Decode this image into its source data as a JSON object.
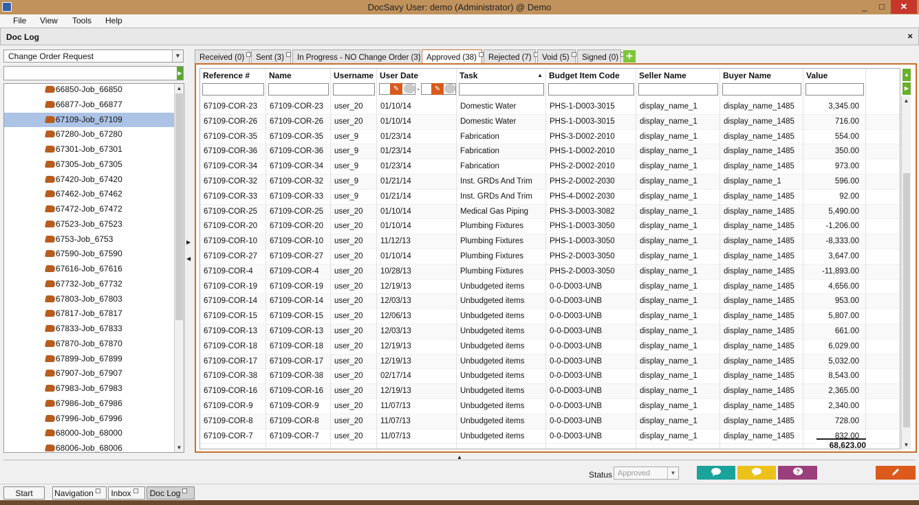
{
  "window": {
    "title": "DocSavy   User: demo (Administrator) @ Demo",
    "min_label": "_",
    "max_label": "□",
    "close_label": "✕"
  },
  "menu": [
    "File",
    "View",
    "Tools",
    "Help"
  ],
  "doclog": {
    "title": "Doc Log",
    "close_label": "×"
  },
  "doc_type": {
    "selected": "Change Order Request"
  },
  "tree": {
    "items": [
      "66850-Job_66850",
      "66877-Job_66877",
      "67109-Job_67109",
      "67280-Job_67280",
      "67301-Job_67301",
      "67305-Job_67305",
      "67420-Job_67420",
      "67462-Job_67462",
      "67472-Job_67472",
      "67523-Job_67523",
      "6753-Job_6753",
      "67590-Job_67590",
      "67616-Job_67616",
      "67732-Job_67732",
      "67803-Job_67803",
      "67817-Job_67817",
      "67833-Job_67833",
      "67870-Job_67870",
      "67899-Job_67899",
      "67907-Job_67907",
      "67983-Job_67983",
      "67986-Job_67986",
      "67996-Job_67996",
      "68000-Job_68000",
      "68006-Job_68006"
    ],
    "selected_index": 2
  },
  "tabs": [
    "Received (0)",
    "Sent (3)",
    "In Progress - NO Change Order (3)",
    "Approved (38)",
    "Rejected (7)",
    "Void (5)",
    "Signed (0)"
  ],
  "active_tab": 3,
  "add_tab_label": "+",
  "columns": [
    "Reference #",
    "Name",
    "Username",
    "User Date",
    "Task",
    "Budget Item Code",
    "Seller Name",
    "Buyer Name",
    "Value"
  ],
  "sort_indicator": "▲",
  "date_separator": "-",
  "rows": [
    [
      "67109-COR-23",
      "67109-COR-23",
      "user_20",
      "01/10/14",
      "Domestic Water",
      "PHS-1-D003-3015",
      "display_name_1",
      "display_name_1485",
      "3,345.00"
    ],
    [
      "67109-COR-26",
      "67109-COR-26",
      "user_20",
      "01/10/14",
      "Domestic Water",
      "PHS-1-D003-3015",
      "display_name_1",
      "display_name_1485",
      "716.00"
    ],
    [
      "67109-COR-35",
      "67109-COR-35",
      "user_9",
      "01/23/14",
      "Fabrication",
      "PHS-3-D002-2010",
      "display_name_1",
      "display_name_1485",
      "554.00"
    ],
    [
      "67109-COR-36",
      "67109-COR-36",
      "user_9",
      "01/23/14",
      "Fabrication",
      "PHS-1-D002-2010",
      "display_name_1",
      "display_name_1485",
      "350.00"
    ],
    [
      "67109-COR-34",
      "67109-COR-34",
      "user_9",
      "01/23/14",
      "Fabrication",
      "PHS-2-D002-2010",
      "display_name_1",
      "display_name_1485",
      "973.00"
    ],
    [
      "67109-COR-32",
      "67109-COR-32",
      "user_9",
      "01/21/14",
      "Inst. GRDs And Trim",
      "PHS-2-D002-2030",
      "display_name_1",
      "display_name_1",
      "596.00"
    ],
    [
      "67109-COR-33",
      "67109-COR-33",
      "user_9",
      "01/21/14",
      "Inst. GRDs And Trim",
      "PHS-4-D002-2030",
      "display_name_1",
      "display_name_1485",
      "92.00"
    ],
    [
      "67109-COR-25",
      "67109-COR-25",
      "user_20",
      "01/10/14",
      "Medical Gas Piping",
      "PHS-3-D003-3082",
      "display_name_1",
      "display_name_1485",
      "5,490.00"
    ],
    [
      "67109-COR-20",
      "67109-COR-20",
      "user_20",
      "01/10/14",
      "Plumbing Fixtures",
      "PHS-1-D003-3050",
      "display_name_1",
      "display_name_1485",
      "-1,206.00"
    ],
    [
      "67109-COR-10",
      "67109-COR-10",
      "user_20",
      "11/12/13",
      "Plumbing Fixtures",
      "PHS-1-D003-3050",
      "display_name_1",
      "display_name_1485",
      "-8,333.00"
    ],
    [
      "67109-COR-27",
      "67109-COR-27",
      "user_20",
      "01/10/14",
      "Plumbing Fixtures",
      "PHS-2-D003-3050",
      "display_name_1",
      "display_name_1485",
      "3,647.00"
    ],
    [
      "67109-COR-4",
      "67109-COR-4",
      "user_20",
      "10/28/13",
      "Plumbing Fixtures",
      "PHS-2-D003-3050",
      "display_name_1",
      "display_name_1485",
      "-11,893.00"
    ],
    [
      "67109-COR-19",
      "67109-COR-19",
      "user_20",
      "12/19/13",
      "Unbudgeted items",
      "0-0-D003-UNB",
      "display_name_1",
      "display_name_1485",
      "4,656.00"
    ],
    [
      "67109-COR-14",
      "67109-COR-14",
      "user_20",
      "12/03/13",
      "Unbudgeted items",
      "0-0-D003-UNB",
      "display_name_1",
      "display_name_1485",
      "953.00"
    ],
    [
      "67109-COR-15",
      "67109-COR-15",
      "user_20",
      "12/06/13",
      "Unbudgeted items",
      "0-0-D003-UNB",
      "display_name_1",
      "display_name_1485",
      "5,807.00"
    ],
    [
      "67109-COR-13",
      "67109-COR-13",
      "user_20",
      "12/03/13",
      "Unbudgeted items",
      "0-0-D003-UNB",
      "display_name_1",
      "display_name_1485",
      "661.00"
    ],
    [
      "67109-COR-18",
      "67109-COR-18",
      "user_20",
      "12/19/13",
      "Unbudgeted items",
      "0-0-D003-UNB",
      "display_name_1",
      "display_name_1485",
      "6,029.00"
    ],
    [
      "67109-COR-17",
      "67109-COR-17",
      "user_20",
      "12/19/13",
      "Unbudgeted items",
      "0-0-D003-UNB",
      "display_name_1",
      "display_name_1485",
      "5,032.00"
    ],
    [
      "67109-COR-38",
      "67109-COR-38",
      "user_20",
      "02/17/14",
      "Unbudgeted items",
      "0-0-D003-UNB",
      "display_name_1",
      "display_name_1485",
      "8,543.00"
    ],
    [
      "67109-COR-16",
      "67109-COR-16",
      "user_20",
      "12/19/13",
      "Unbudgeted items",
      "0-0-D003-UNB",
      "display_name_1",
      "display_name_1485",
      "2,365.00"
    ],
    [
      "67109-COR-9",
      "67109-COR-9",
      "user_20",
      "11/07/13",
      "Unbudgeted items",
      "0-0-D003-UNB",
      "display_name_1",
      "display_name_1485",
      "2,340.00"
    ],
    [
      "67109-COR-8",
      "67109-COR-8",
      "user_20",
      "11/07/13",
      "Unbudgeted items",
      "0-0-D003-UNB",
      "display_name_1",
      "display_name_1485",
      "728.00"
    ],
    [
      "67109-COR-7",
      "67109-COR-7",
      "user_20",
      "11/07/13",
      "Unbudgeted items",
      "0-0-D003-UNB",
      "display_name_1",
      "display_name_1485",
      "832.00"
    ]
  ],
  "total": "68,623.00",
  "status": {
    "label": "Status",
    "selected": "Approved"
  },
  "action_colors": {
    "teal": "#1aa39a",
    "yellow": "#ecc21a",
    "purple": "#9a3f7b",
    "orange": "#db5a1c"
  },
  "action_icons": [
    "chat-icon",
    "comment-icon",
    "help-icon",
    "edit-icon"
  ],
  "taskbar": {
    "start": "Start",
    "items": [
      "Navigation",
      "Inbox",
      "Doc Log"
    ],
    "active_index": 2
  }
}
